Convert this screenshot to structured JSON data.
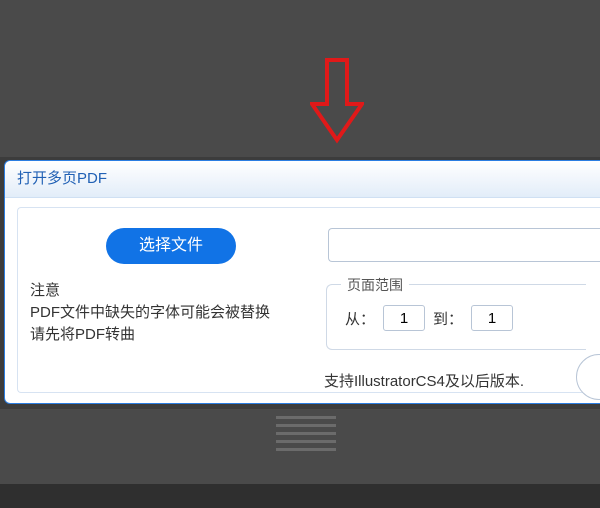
{
  "dialog": {
    "title": "打开多页PDF",
    "choose_file_label": "选择文件",
    "file_path_value": "",
    "note_heading": "注意",
    "note_line1": "PDF文件中缺失的字体可能会被替换",
    "note_line2": "请先将PDF转曲",
    "page_range": {
      "legend": "页面范围",
      "from_label": "从：",
      "from_value": "1",
      "to_label": "到：",
      "to_value": "1"
    },
    "support_text": "支持IllustratorCS4及以后版本."
  },
  "annotation": {
    "arrow_color": "#e01919"
  }
}
